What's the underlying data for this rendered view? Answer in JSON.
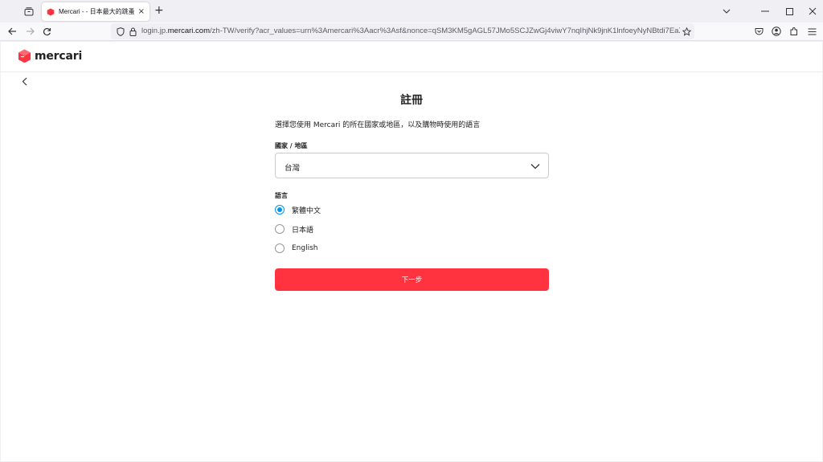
{
  "browser": {
    "tab": {
      "title": "Mercari -  - 日本最大的跳蚤市場",
      "close_glyph": "×"
    },
    "new_tab_glyph": "+",
    "url": {
      "prefix": "login.jp.",
      "domain": "mercari.com",
      "rest": "/zh-TW/verify?acr_values=urn%3Amercari%3Aacr%3Asf&nonce=qSM3KM5gAGL57JMo5SCJZwGj4viwY7nqIhjNk9jnK1lnfoeyNyNBtdi7EaXx&params=cl"
    },
    "icons": [
      "tab-list-icon",
      "back-arrow-icon",
      "forward-arrow-icon",
      "reload-icon",
      "shield-icon",
      "lock-icon",
      "star-icon",
      "pocket-icon",
      "account-icon",
      "extensions-icon",
      "menu-icon",
      "minimize-icon",
      "maximize-icon",
      "close-window-icon",
      "chevron-down-icon"
    ]
  },
  "site": {
    "logo_text": "mercari",
    "brand_color": "#ff333f"
  },
  "page": {
    "title": "註冊",
    "intro": "選擇您使用 Mercari 的所在國家或地區，以及購物時使用的語言",
    "country_label": "國家 / 地區",
    "country_value": "台灣",
    "language_label": "語言",
    "languages": [
      {
        "label": "繁體中文",
        "checked": true
      },
      {
        "label": "日本語",
        "checked": false
      },
      {
        "label": "English",
        "checked": false
      }
    ],
    "next_button": "下一步"
  },
  "colors": {
    "radio_checked": "#0095ee",
    "button_bg": "#ff333f"
  }
}
